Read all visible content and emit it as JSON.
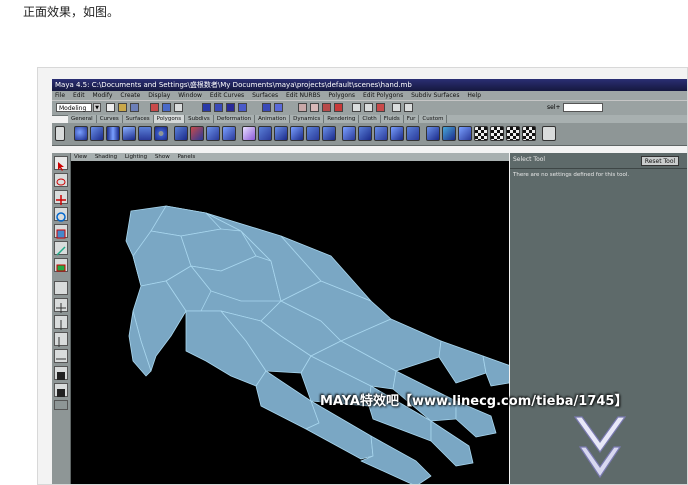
{
  "page": {
    "caption": "正面效果，如图。"
  },
  "maya": {
    "title": "Maya 4.5: C:\\Documents and Settings\\盛根数者\\My Documents\\maya\\projects\\default\\scenes\\hand.mb",
    "menus": [
      "File",
      "Edit",
      "Modify",
      "Create",
      "Display",
      "Window",
      "Edit Curves",
      "Surfaces",
      "Edit NURBS",
      "Polygons",
      "Edit Polygons",
      "Subdiv Surfaces",
      "Help"
    ],
    "mode": "Modeling",
    "sel_label": "sel+",
    "shelf_tabs": [
      "General",
      "Curves",
      "Surfaces",
      "Polygons",
      "Subdivs",
      "Deformation",
      "Animation",
      "Dynamics",
      "Rendering",
      "Cloth",
      "Fluids",
      "Fur",
      "Custom"
    ],
    "active_shelf": "Polygons",
    "panel_menus": [
      "View",
      "Shading",
      "Lighting",
      "Show",
      "Panels"
    ],
    "tool_settings": {
      "header": "Select Tool",
      "reset_label": "Reset Tool",
      "message": "There are no settings defined for this tool."
    }
  },
  "watermark": {
    "text": "MAYA特效吧【www.linecg.com/tieba/1745】"
  },
  "colors": {
    "hand_fill": "#7aa7c4",
    "hand_edges": "#a8d6ee",
    "viewport_bg": "#000000",
    "ui_gray": "#9aa2a2"
  }
}
